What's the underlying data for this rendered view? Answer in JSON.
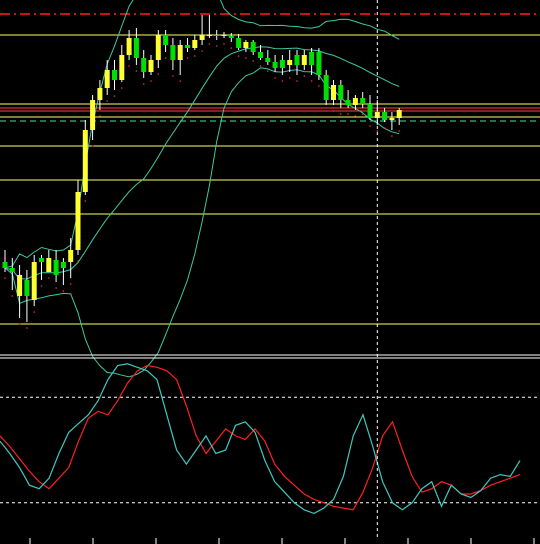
{
  "chart_data": [
    {
      "type": "candlestick",
      "title": "",
      "xlabel": "",
      "ylabel": "",
      "ylim": [
        0,
        355
      ],
      "grid": false,
      "colors": {
        "background": "#000000",
        "bull_body": "#00e000",
        "bear_body": "#ffff33",
        "wick": "#ffffff",
        "bollinger": "#40c8a0",
        "sar": "#ff3030",
        "level_line": "#ffff66",
        "red_line": "#ff4040",
        "dash_red": "#ff2020",
        "dash_green": "#40e0a0",
        "crosshair": "#ffffff"
      },
      "levels_yellow": [
        35,
        104,
        117,
        146,
        180,
        214,
        324
      ],
      "levels_red": [
        108,
        111
      ],
      "level_green_dashed": 121,
      "level_red_dashdot": 14,
      "crosshair_x_index": 51,
      "candles": [
        {
          "o": 262,
          "h": 250,
          "l": 272,
          "c": 268,
          "bull": true
        },
        {
          "o": 268,
          "h": 258,
          "l": 290,
          "c": 272,
          "bull": true
        },
        {
          "o": 275,
          "h": 265,
          "l": 318,
          "c": 296,
          "bull": false
        },
        {
          "o": 296,
          "h": 270,
          "l": 322,
          "c": 280,
          "bull": true
        },
        {
          "o": 300,
          "h": 255,
          "l": 306,
          "c": 262,
          "bull": false
        },
        {
          "o": 262,
          "h": 255,
          "l": 280,
          "c": 258,
          "bull": true
        },
        {
          "o": 258,
          "h": 250,
          "l": 272,
          "c": 272,
          "bull": false
        },
        {
          "o": 260,
          "h": 250,
          "l": 282,
          "c": 275,
          "bull": true
        },
        {
          "o": 268,
          "h": 258,
          "l": 285,
          "c": 262,
          "bull": true
        },
        {
          "o": 262,
          "h": 238,
          "l": 278,
          "c": 250,
          "bull": false
        },
        {
          "o": 250,
          "h": 180,
          "l": 255,
          "c": 192,
          "bull": false
        },
        {
          "o": 192,
          "h": 120,
          "l": 195,
          "c": 130,
          "bull": false
        },
        {
          "o": 130,
          "h": 95,
          "l": 140,
          "c": 100,
          "bull": false
        },
        {
          "o": 100,
          "h": 80,
          "l": 110,
          "c": 88,
          "bull": false
        },
        {
          "o": 88,
          "h": 60,
          "l": 95,
          "c": 70,
          "bull": false
        },
        {
          "o": 70,
          "h": 60,
          "l": 90,
          "c": 80,
          "bull": true
        },
        {
          "o": 80,
          "h": 45,
          "l": 82,
          "c": 55,
          "bull": false
        },
        {
          "o": 55,
          "h": 30,
          "l": 60,
          "c": 38,
          "bull": false
        },
        {
          "o": 38,
          "h": 28,
          "l": 65,
          "c": 58,
          "bull": true
        },
        {
          "o": 58,
          "h": 50,
          "l": 78,
          "c": 72,
          "bull": true
        },
        {
          "o": 72,
          "h": 55,
          "l": 75,
          "c": 60,
          "bull": false
        },
        {
          "o": 60,
          "h": 30,
          "l": 68,
          "c": 35,
          "bull": false
        },
        {
          "o": 35,
          "h": 30,
          "l": 52,
          "c": 45,
          "bull": true
        },
        {
          "o": 45,
          "h": 38,
          "l": 70,
          "c": 60,
          "bull": true
        },
        {
          "o": 60,
          "h": 40,
          "l": 75,
          "c": 45,
          "bull": false
        },
        {
          "o": 45,
          "h": 38,
          "l": 52,
          "c": 48,
          "bull": true
        },
        {
          "o": 48,
          "h": 35,
          "l": 50,
          "c": 40,
          "bull": false
        },
        {
          "o": 40,
          "h": 15,
          "l": 45,
          "c": 35,
          "bull": false
        },
        {
          "o": 35,
          "h": 15,
          "l": 38,
          "c": 36,
          "bull": false
        },
        {
          "o": 36,
          "h": 30,
          "l": 40,
          "c": 35,
          "bull": true
        },
        {
          "o": 35,
          "h": 32,
          "l": 38,
          "c": 36,
          "bull": false
        },
        {
          "o": 36,
          "h": 33,
          "l": 42,
          "c": 38,
          "bull": true
        },
        {
          "o": 38,
          "h": 34,
          "l": 50,
          "c": 48,
          "bull": true
        },
        {
          "o": 48,
          "h": 40,
          "l": 52,
          "c": 42,
          "bull": false
        },
        {
          "o": 42,
          "h": 40,
          "l": 55,
          "c": 52,
          "bull": true
        },
        {
          "o": 52,
          "h": 45,
          "l": 60,
          "c": 58,
          "bull": true
        },
        {
          "o": 58,
          "h": 50,
          "l": 65,
          "c": 62,
          "bull": true
        },
        {
          "o": 62,
          "h": 55,
          "l": 72,
          "c": 68,
          "bull": true
        },
        {
          "o": 68,
          "h": 55,
          "l": 75,
          "c": 60,
          "bull": true
        },
        {
          "o": 60,
          "h": 50,
          "l": 72,
          "c": 65,
          "bull": false
        },
        {
          "o": 65,
          "h": 50,
          "l": 75,
          "c": 55,
          "bull": true
        },
        {
          "o": 55,
          "h": 50,
          "l": 70,
          "c": 65,
          "bull": false
        },
        {
          "o": 65,
          "h": 48,
          "l": 75,
          "c": 52,
          "bull": true
        },
        {
          "o": 52,
          "h": 48,
          "l": 80,
          "c": 75,
          "bull": true
        },
        {
          "o": 75,
          "h": 70,
          "l": 105,
          "c": 100,
          "bull": true
        },
        {
          "o": 100,
          "h": 80,
          "l": 105,
          "c": 85,
          "bull": false
        },
        {
          "o": 85,
          "h": 80,
          "l": 108,
          "c": 100,
          "bull": true
        },
        {
          "o": 100,
          "h": 90,
          "l": 108,
          "c": 105,
          "bull": true
        },
        {
          "o": 105,
          "h": 95,
          "l": 110,
          "c": 98,
          "bull": false
        },
        {
          "o": 98,
          "h": 92,
          "l": 108,
          "c": 104,
          "bull": true
        },
        {
          "o": 104,
          "h": 95,
          "l": 120,
          "c": 118,
          "bull": true
        },
        {
          "o": 118,
          "h": 100,
          "l": 125,
          "c": 112,
          "bull": false
        },
        {
          "o": 112,
          "h": 108,
          "l": 122,
          "c": 120,
          "bull": true
        },
        {
          "o": 120,
          "h": 112,
          "l": 130,
          "c": 118,
          "bull": false
        },
        {
          "o": 118,
          "h": 108,
          "l": 125,
          "c": 110,
          "bull": false
        }
      ]
    },
    {
      "type": "line",
      "title": "",
      "xlabel": "",
      "ylabel": "",
      "ylim": [
        0,
        100
      ],
      "grid": false,
      "levels_dashed": [
        80,
        20
      ],
      "series": [
        {
          "values": [
            58,
            52,
            45,
            38,
            32,
            28,
            34,
            40,
            55,
            68,
            72,
            70,
            78,
            88,
            95,
            98,
            97,
            95,
            90,
            75,
            58,
            48,
            55,
            62,
            58,
            56,
            62,
            55,
            42,
            35,
            30,
            25,
            22,
            20,
            18,
            17,
            16,
            26,
            40,
            58,
            66,
            50,
            35,
            26,
            28,
            32,
            30,
            25,
            25,
            27,
            30,
            32,
            34,
            36
          ]
        },
        {
          "values": [
            55,
            48,
            40,
            30,
            28,
            34,
            48,
            60,
            65,
            70,
            78,
            90,
            98,
            99,
            97,
            95,
            90,
            70,
            50,
            42,
            50,
            58,
            48,
            50,
            64,
            66,
            60,
            44,
            32,
            26,
            20,
            16,
            14,
            17,
            22,
            35,
            58,
            70,
            52,
            32,
            20,
            16,
            20,
            28,
            32,
            18,
            30,
            25,
            23,
            27,
            34,
            36,
            35,
            44
          ]
        }
      ],
      "colors": {
        "main": "#40c8c0",
        "signal": "#ff2020",
        "level": "#ffffff"
      }
    }
  ]
}
